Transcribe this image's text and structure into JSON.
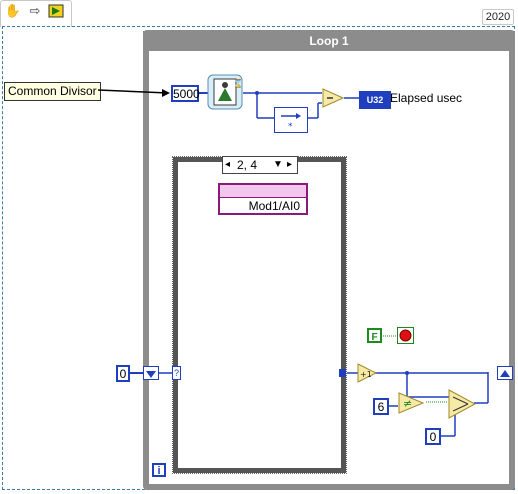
{
  "toolbar": {
    "icons": [
      "hand-icon",
      "arrow-right-icon",
      "run-icon"
    ],
    "version": "2020"
  },
  "loop": {
    "title": "Loop 1"
  },
  "labels": {
    "common_divisor": "Common Divisor",
    "elapsed": "Elapsed usec",
    "u32": "U32"
  },
  "constants": {
    "timer_value": "5000",
    "case_selector": "2, 4",
    "channel": "Mod1/AI0",
    "shift_init": "0",
    "compare_value": "6",
    "select_false": "0",
    "bool_false": "F",
    "iteration": "i",
    "question": "?",
    "increment": "+1"
  },
  "colors": {
    "wire": "#1f3fbf",
    "loop_frame": "#8c8c8c",
    "boolean": "#1d8a1d",
    "stop": "#e01010",
    "io_purple": "#8a1a7a",
    "label_bg": "#ffffe1"
  }
}
